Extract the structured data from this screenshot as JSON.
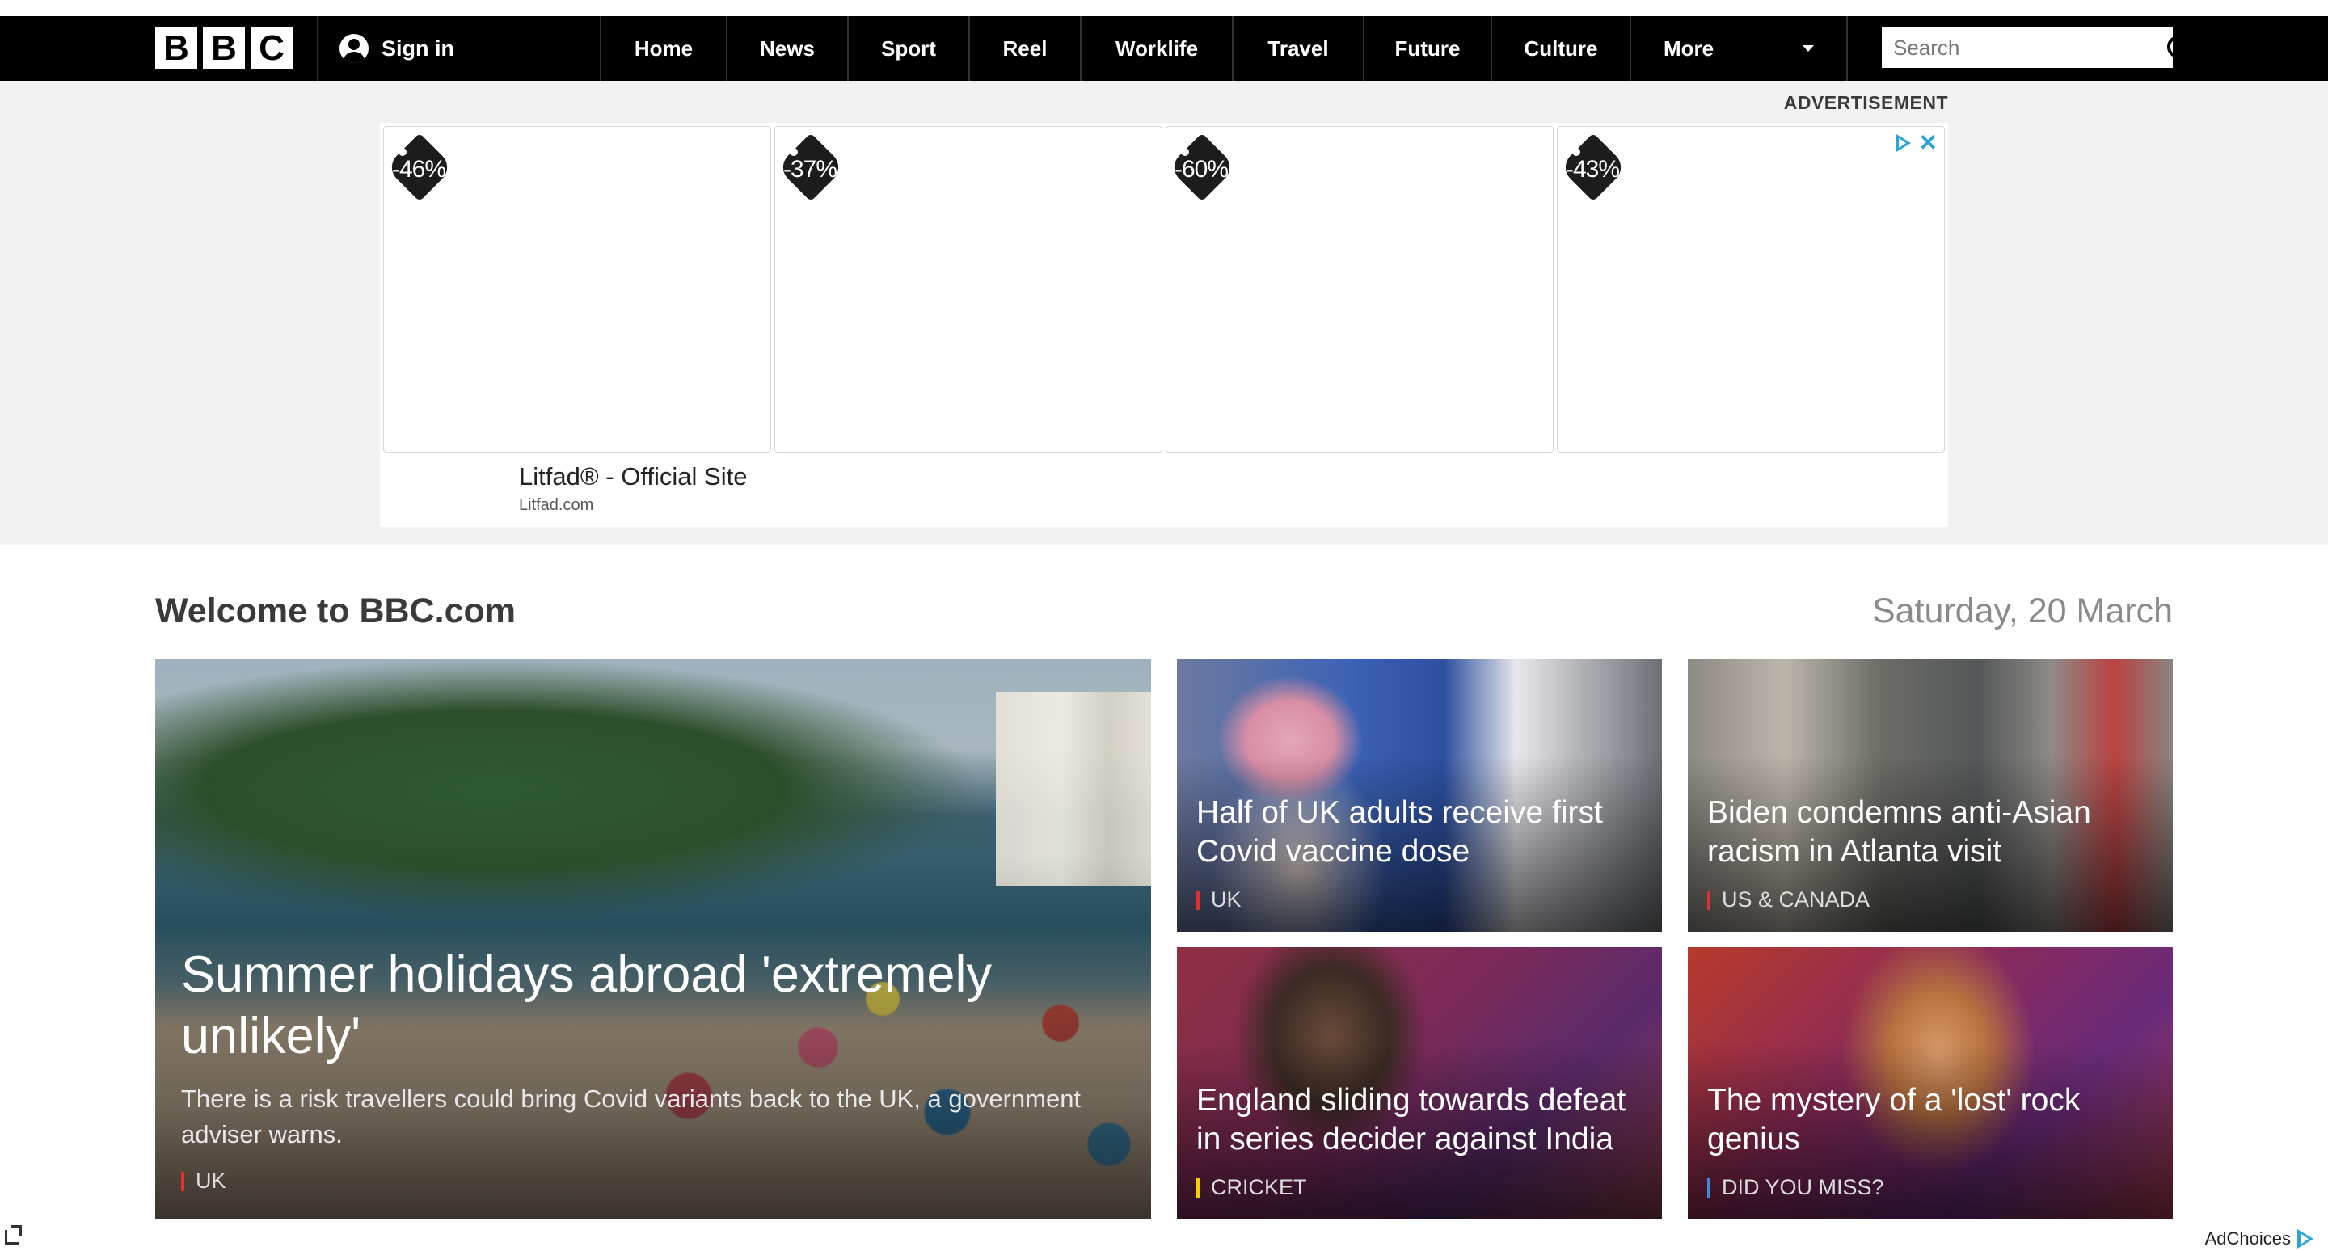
{
  "nav": {
    "logo_letters": [
      "B",
      "B",
      "C"
    ],
    "sign_in": "Sign in",
    "items": [
      "Home",
      "News",
      "Sport",
      "Reel",
      "Worklife",
      "Travel",
      "Future",
      "Culture"
    ],
    "more": "More",
    "search_placeholder": "Search"
  },
  "ad": {
    "label": "ADVERTISEMENT",
    "tiles": [
      {
        "discount": "-46%"
      },
      {
        "discount": "-37%"
      },
      {
        "discount": "-60%"
      },
      {
        "discount": "-43%"
      }
    ],
    "title": "Litfad® - Official Site",
    "url": "Litfad.com"
  },
  "welcome": {
    "title": "Welcome to BBC.com",
    "date": "Saturday, 20 March"
  },
  "stories": [
    {
      "headline": "Summer holidays abroad 'extremely unlikely'",
      "summary": "There is a risk travellers could bring Covid variants back to the UK, a government adviser warns.",
      "category": "UK",
      "category_color": "#e03030"
    },
    {
      "headline": "Half of UK adults receive first Covid vaccine dose",
      "category": "UK",
      "category_color": "#e03030"
    },
    {
      "headline": "Biden condemns anti-Asian racism in Atlanta visit",
      "category": "US & CANADA",
      "category_color": "#e03030"
    },
    {
      "headline": "England sliding towards defeat in series decider against India",
      "category": "CRICKET",
      "category_color": "#f5d000"
    },
    {
      "headline": "The mystery of a 'lost' rock genius",
      "category": "DID YOU MISS?",
      "category_color": "#3a8fd8"
    }
  ],
  "footer": {
    "adchoices": "AdChoices"
  }
}
